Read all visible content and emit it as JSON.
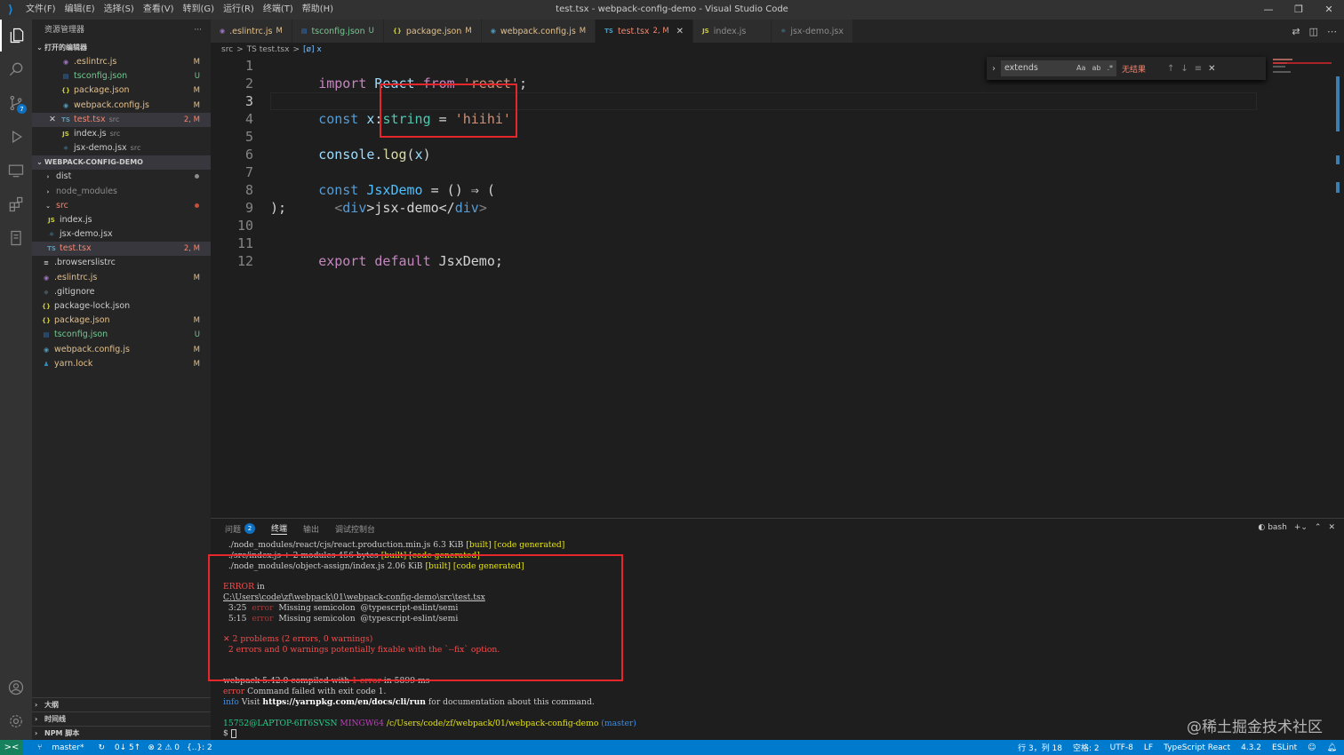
{
  "titlebar": {
    "menu": [
      "文件(F)",
      "编辑(E)",
      "选择(S)",
      "查看(V)",
      "转到(G)",
      "运行(R)",
      "终端(T)",
      "帮助(H)"
    ],
    "title": "test.tsx - webpack-config-demo - Visual Studio Code"
  },
  "activity": [
    "files-icon",
    "search-icon",
    "source-control-icon",
    "run-debug-icon",
    "remote-explorer-icon",
    "extensions-icon",
    "test-icon",
    "account-icon",
    "settings-gear-icon"
  ],
  "activity_badge": "7",
  "sidebar": {
    "title": "资源管理器",
    "more": "···",
    "open_editors_title": "打开的编辑器",
    "open_editors": [
      {
        "name": ".eslintrc.js",
        "icon": "◉",
        "status": "M"
      },
      {
        "name": "tsconfig.json",
        "icon": "▤",
        "status": "U"
      },
      {
        "name": "package.json",
        "icon": "{}",
        "status": "M"
      },
      {
        "name": "webpack.config.js",
        "icon": "◉",
        "status": "M"
      },
      {
        "name": "test.tsx",
        "sub": "src",
        "icon": "TS",
        "status": "2, M"
      },
      {
        "name": "index.js",
        "sub": "src",
        "icon": "JS",
        "status": ""
      },
      {
        "name": "jsx-demo.jsx",
        "sub": "src",
        "icon": "⚛",
        "status": ""
      }
    ],
    "project_title": "WEBPACK-CONFIG-DEMO",
    "tree": {
      "dist": "dist",
      "node_modules": "node_modules",
      "src": "src",
      "src_files": [
        {
          "name": "index.js",
          "icon": "JS"
        },
        {
          "name": "jsx-demo.jsx",
          "icon": "⚛"
        },
        {
          "name": "test.tsx",
          "icon": "TS",
          "status": "2, M"
        }
      ],
      "root_files": [
        {
          "name": ".browserslistrc",
          "icon": "≡",
          "status": ""
        },
        {
          "name": ".eslintrc.js",
          "icon": "◉",
          "status": "M"
        },
        {
          "name": ".gitignore",
          "icon": "◆",
          "status": ""
        },
        {
          "name": "package-lock.json",
          "icon": "{}",
          "status": ""
        },
        {
          "name": "package.json",
          "icon": "{}",
          "status": "M"
        },
        {
          "name": "tsconfig.json",
          "icon": "▤",
          "status": "U"
        },
        {
          "name": "webpack.config.js",
          "icon": "◉",
          "status": "M"
        },
        {
          "name": "yarn.lock",
          "icon": "♟",
          "status": "M"
        }
      ]
    },
    "bottom_sections": [
      "大纲",
      "时间线",
      "NPM 脚本"
    ]
  },
  "tabs": [
    {
      "name": ".eslintrc.js",
      "icon": "◉",
      "status": "M"
    },
    {
      "name": "tsconfig.json",
      "icon": "▤",
      "status": "U"
    },
    {
      "name": "package.json",
      "icon": "{}",
      "status": "M"
    },
    {
      "name": "webpack.config.js",
      "icon": "◉",
      "status": "M"
    },
    {
      "name": "test.tsx",
      "icon": "TS",
      "status": "2, M"
    },
    {
      "name": "index.js",
      "icon": "JS",
      "status": ""
    },
    {
      "name": "jsx-demo.jsx",
      "icon": "⚛",
      "status": ""
    }
  ],
  "breadcrumb": [
    "src",
    ">",
    "TS test.tsx",
    ">",
    "[ø] x"
  ],
  "editor": {
    "line_numbers": [
      "1",
      "2",
      "3",
      "4",
      "5",
      "6",
      "7",
      "8",
      "9",
      "10",
      "11",
      "12"
    ],
    "l1": {
      "a": "import",
      "b": " React ",
      "c": "from",
      "d": " 'react'",
      "e": ";"
    },
    "l3": {
      "a": "const",
      "b": " x",
      "c": ":",
      "d": "string",
      "e": " = ",
      "f": "'hiihi'"
    },
    "l5": {
      "a": "console",
      "b": ".",
      "c": "log",
      "d": "(",
      "e": "x",
      "f": ")"
    },
    "l7": {
      "a": "const",
      "b": " JsxDemo",
      "c": " = () ⇒ ("
    },
    "l8": {
      "a": "  <",
      "b": "div",
      "c": ">jsx-demo</",
      "d": "div",
      "e": ">"
    },
    "l9": {
      "a": ");"
    },
    "l11": {
      "a": "export",
      "b": " default",
      "c": " JsxDemo;"
    }
  },
  "find": {
    "query": "extends",
    "options": [
      "Aa",
      "ab",
      ".*"
    ],
    "result": "无结果"
  },
  "panel": {
    "tabs": [
      "问题",
      "终端",
      "输出",
      "调试控制台"
    ],
    "problems_count": "2",
    "shell": "bash",
    "terminal": {
      "l1a": "  ./node_modules/react/cjs/react.production.min.js",
      "l1b": " 6.3 KiB ",
      "l1c": "[built] [code generated]",
      "l2a": "  ./src/index.js + 2 modules",
      "l2b": " 456 bytes ",
      "l2c": "[built] [code generated]",
      "l3a": "  ./node_modules/object-assign/index.js",
      "l3b": " 2.06 KiB ",
      "l3c": "[built] [code generated]",
      "err1": "ERROR",
      "err1b": " in",
      "path": "C:\\Users\\code\\zf\\webpack\\01\\webpack-config-demo\\src\\test.tsx",
      "e1a": "  3:25  ",
      "e1b": "error",
      "e1c": "  Missing semicolon  @typescript-eslint/semi",
      "e2a": "  5:15  ",
      "e2b": "error",
      "e2c": "  Missing semicolon  @typescript-eslint/semi",
      "sum1": "✕ 2 problems (2 errors, 0 warnings)",
      "sum2": "  2 errors and 0 warnings potentially fixable with the `--fix` option.",
      "comp_a": "webpack 5.42.0 compiled with ",
      "comp_b": "1 error",
      "comp_c": " in 5899 ms",
      "fail_a": "error",
      "fail_b": " Command failed with exit code 1.",
      "info_a": "info",
      "info_b": " Visit ",
      "info_c": "https://yarnpkg.com/en/docs/cli/run",
      "info_d": " for documentation about this command.",
      "prompt_user": "15752@LAPTOP-6IT6SVSN",
      "prompt_shell": " MINGW64",
      "prompt_path": " /c/Users/code/zf/webpack/01/webpack-config-demo",
      "prompt_branch": " (master)",
      "prompt": "$ "
    }
  },
  "watermark": "@稀土掘金技术社区",
  "statusbar": {
    "remote": "><",
    "branch": "master*",
    "sync": "0↓ 5↑",
    "problems": "⊗ 2 ⚠ 0",
    "braces": "{..}: 2",
    "position": "行 3，列 18",
    "spaces": "空格: 2",
    "encoding": "UTF-8",
    "eol": "LF",
    "language": "TypeScript React",
    "version": "4.3.2",
    "eslint": "ESLint"
  },
  "colors": {
    "accent": "#007acc",
    "highlight_box": "#e5272b",
    "modified": "#e2c08d",
    "untracked": "#73c991",
    "error": "#f48771"
  }
}
